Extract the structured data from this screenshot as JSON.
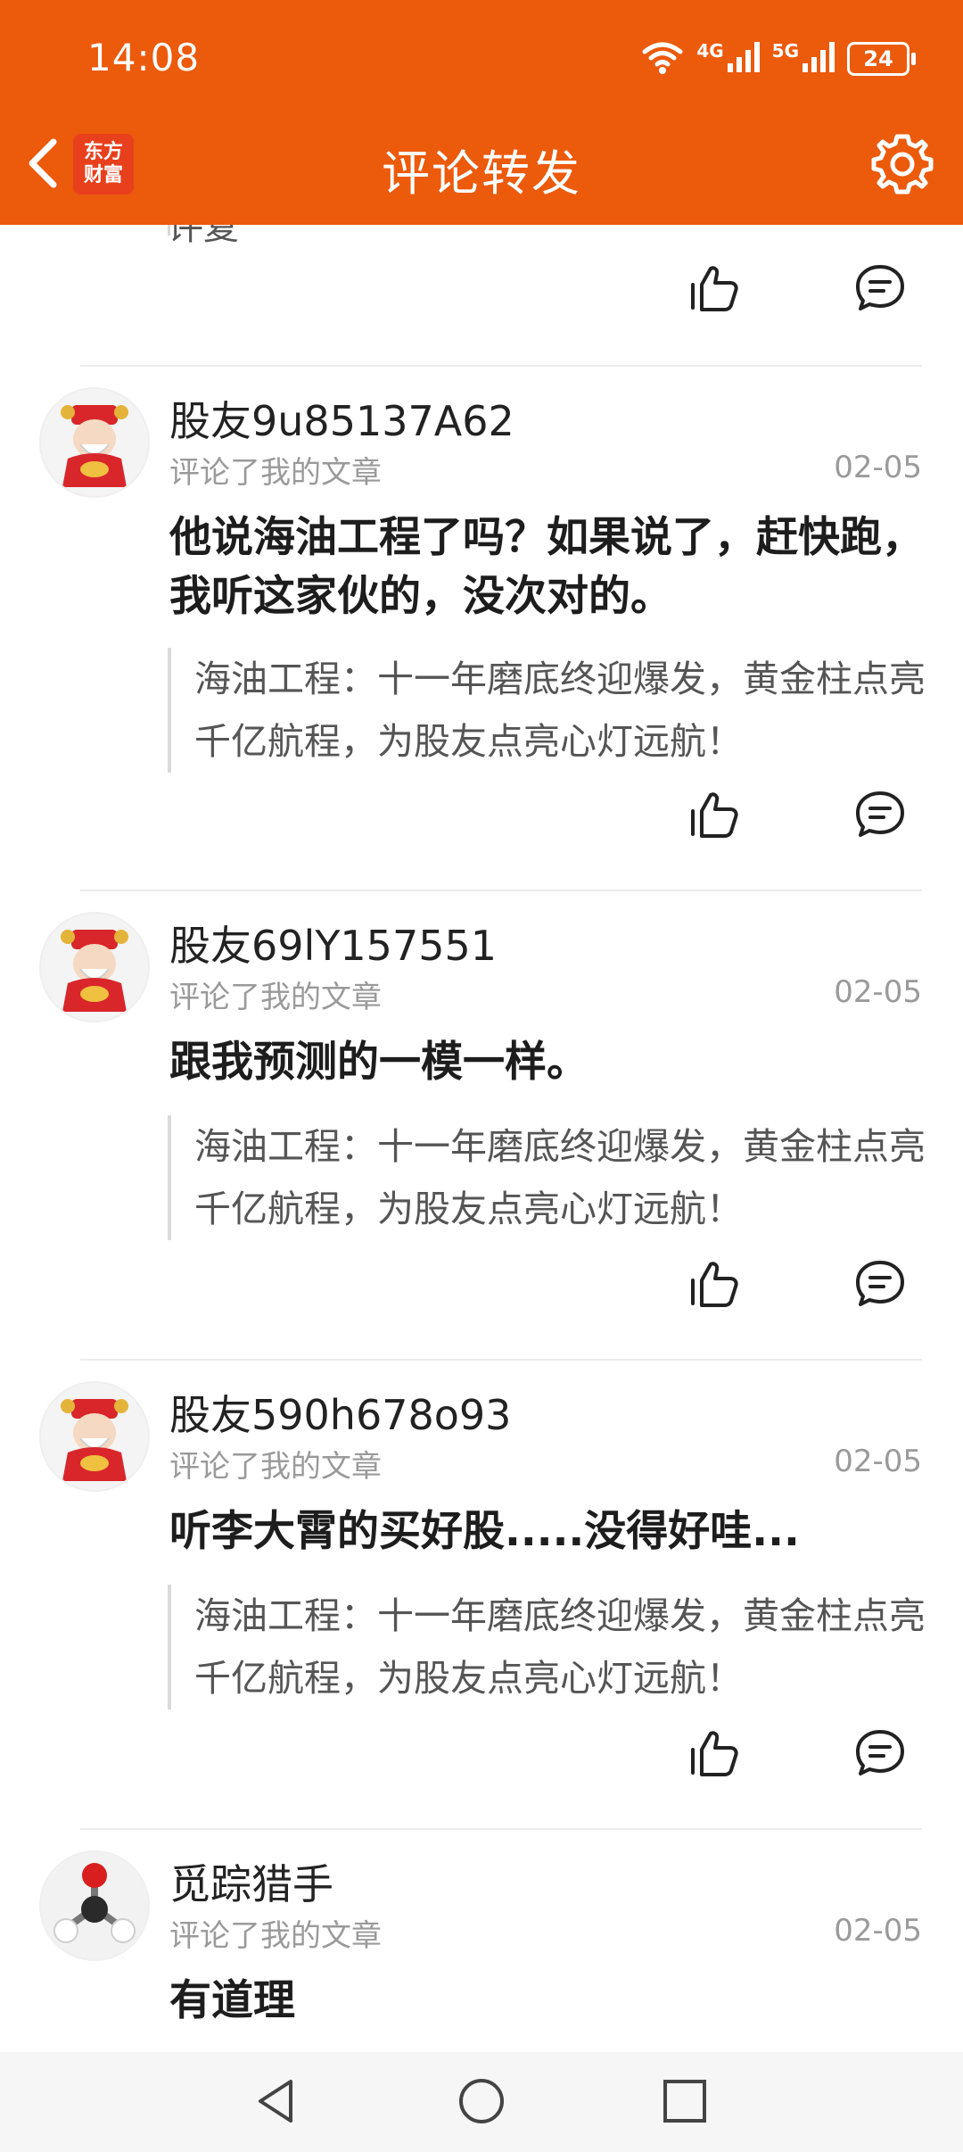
{
  "status_bar": {
    "time": "14:08",
    "network_a": "4G",
    "network_b": "5G",
    "battery": "24"
  },
  "header": {
    "title": "评论转发",
    "logo_line1": "东方",
    "logo_line2": "财富",
    "accent_color": "#ec5a0c"
  },
  "feed": {
    "partial_top_text": "评复",
    "items": [
      {
        "username": "股友9u85137A62",
        "subtitle": "评论了我的文章",
        "date": "02-05",
        "comment": "他说海油工程了吗？如果说了，赶快跑，我听这家伙的，没次对的。",
        "quote": "海油工程：十一年磨底终迎爆发，黄金柱点亮千亿航程，为股友点亮心灯远航！",
        "avatar": "caishen-avatar"
      },
      {
        "username": "股友69lY157551",
        "subtitle": "评论了我的文章",
        "date": "02-05",
        "comment": "跟我预测的一模一样。",
        "quote": "海油工程：十一年磨底终迎爆发，黄金柱点亮千亿航程，为股友点亮心灯远航！",
        "avatar": "caishen-avatar"
      },
      {
        "username": "股友590h678o93",
        "subtitle": "评论了我的文章",
        "date": "02-05",
        "comment": "听李大霄的买好股.....没得好哇...",
        "quote": "海油工程：十一年磨底终迎爆发，黄金柱点亮千亿航程，为股友点亮心灯远航！",
        "avatar": "caishen-avatar"
      },
      {
        "username": "觅踪猎手",
        "subtitle": "评论了我的文章",
        "date": "02-05",
        "comment": "有道理",
        "avatar": "molecule-avatar"
      }
    ]
  },
  "icons": {
    "like": "thumbs-up-icon",
    "reply": "comment-icon",
    "back": "chevron-left-icon",
    "settings": "gear-icon"
  }
}
